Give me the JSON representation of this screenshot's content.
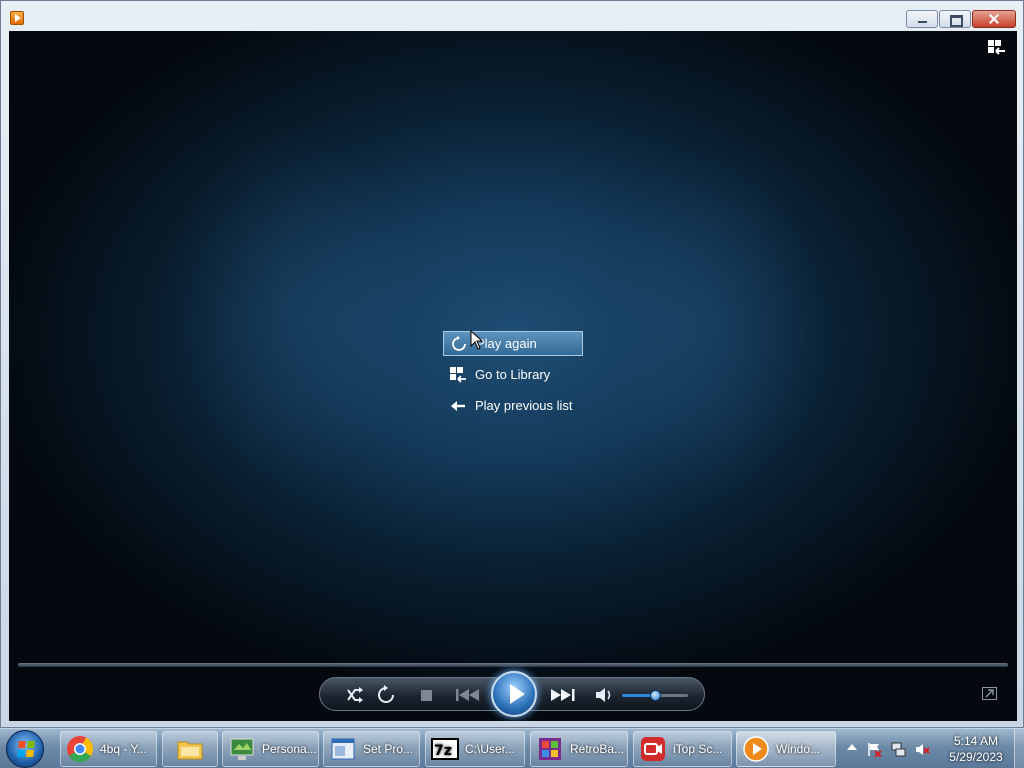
{
  "window": {
    "title": "",
    "app_icon": "media-player-icon",
    "controls": [
      "minimize",
      "maximize",
      "close"
    ]
  },
  "player": {
    "switch_icon": "switch-to-library-icon",
    "menu": [
      {
        "label": "Play again",
        "icon": "replay-icon",
        "active": true
      },
      {
        "label": "Go to Library",
        "icon": "library-icon",
        "active": false
      },
      {
        "label": "Play previous list",
        "icon": "back-arrow-icon",
        "active": false
      }
    ],
    "controls": {
      "buttons": [
        "shuffle-icon",
        "repeat-icon",
        "stop-icon",
        "previous-icon",
        "play-icon",
        "next-icon",
        "volume-icon"
      ],
      "volume_level": 0.5
    },
    "fullscreen_icon": "fullscreen-icon"
  },
  "taskbar": {
    "items": [
      {
        "label": "4bq - Y...",
        "icon": "chrome-icon",
        "color": "#e8443a"
      },
      {
        "label": "",
        "icon": "folder-icon",
        "color": "#f3c64e"
      },
      {
        "label": "Persona...",
        "icon": "personalization-icon",
        "color": "#3b8a3e"
      },
      {
        "label": "Set Pro...",
        "icon": "window-icon",
        "color": "#2f6cb5"
      },
      {
        "label": "C:\\User...",
        "icon": "7zip-icon",
        "color": "#1a1a1a"
      },
      {
        "label": "RetroBa...",
        "icon": "retrobar-icon",
        "color": "#7a2b8c"
      },
      {
        "label": "iTop Sc...",
        "icon": "itop-screen-recorder-icon",
        "color": "#d12b2b"
      },
      {
        "label": "Windo...",
        "icon": "windows-media-player-icon",
        "color": "#f08a1c"
      }
    ],
    "tray": {
      "icons": [
        "action-center-icon",
        "network-icon",
        "volume-muted-icon"
      ],
      "time": "5:14 AM",
      "date": "5/29/2023"
    }
  },
  "accent": "#336a96"
}
